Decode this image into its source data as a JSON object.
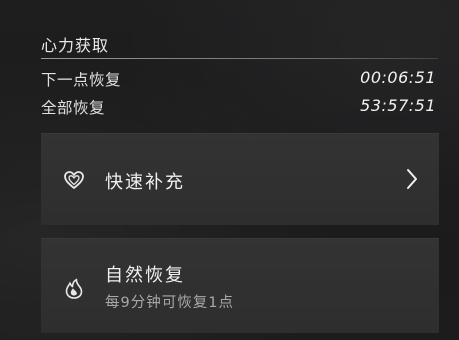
{
  "section": {
    "title": "心力获取"
  },
  "rows": {
    "next_point": {
      "label": "下一点恢复",
      "value": "00:06:51"
    },
    "full_recovery": {
      "label": "全部恢复",
      "value": "53:57:51"
    }
  },
  "cards": {
    "quick_refill": {
      "title": "快速补充",
      "icon": "heart-outline-icon"
    },
    "natural_recovery": {
      "title": "自然恢复",
      "subtitle": "每9分钟可恢复1点",
      "icon": "flame-icon"
    }
  }
}
